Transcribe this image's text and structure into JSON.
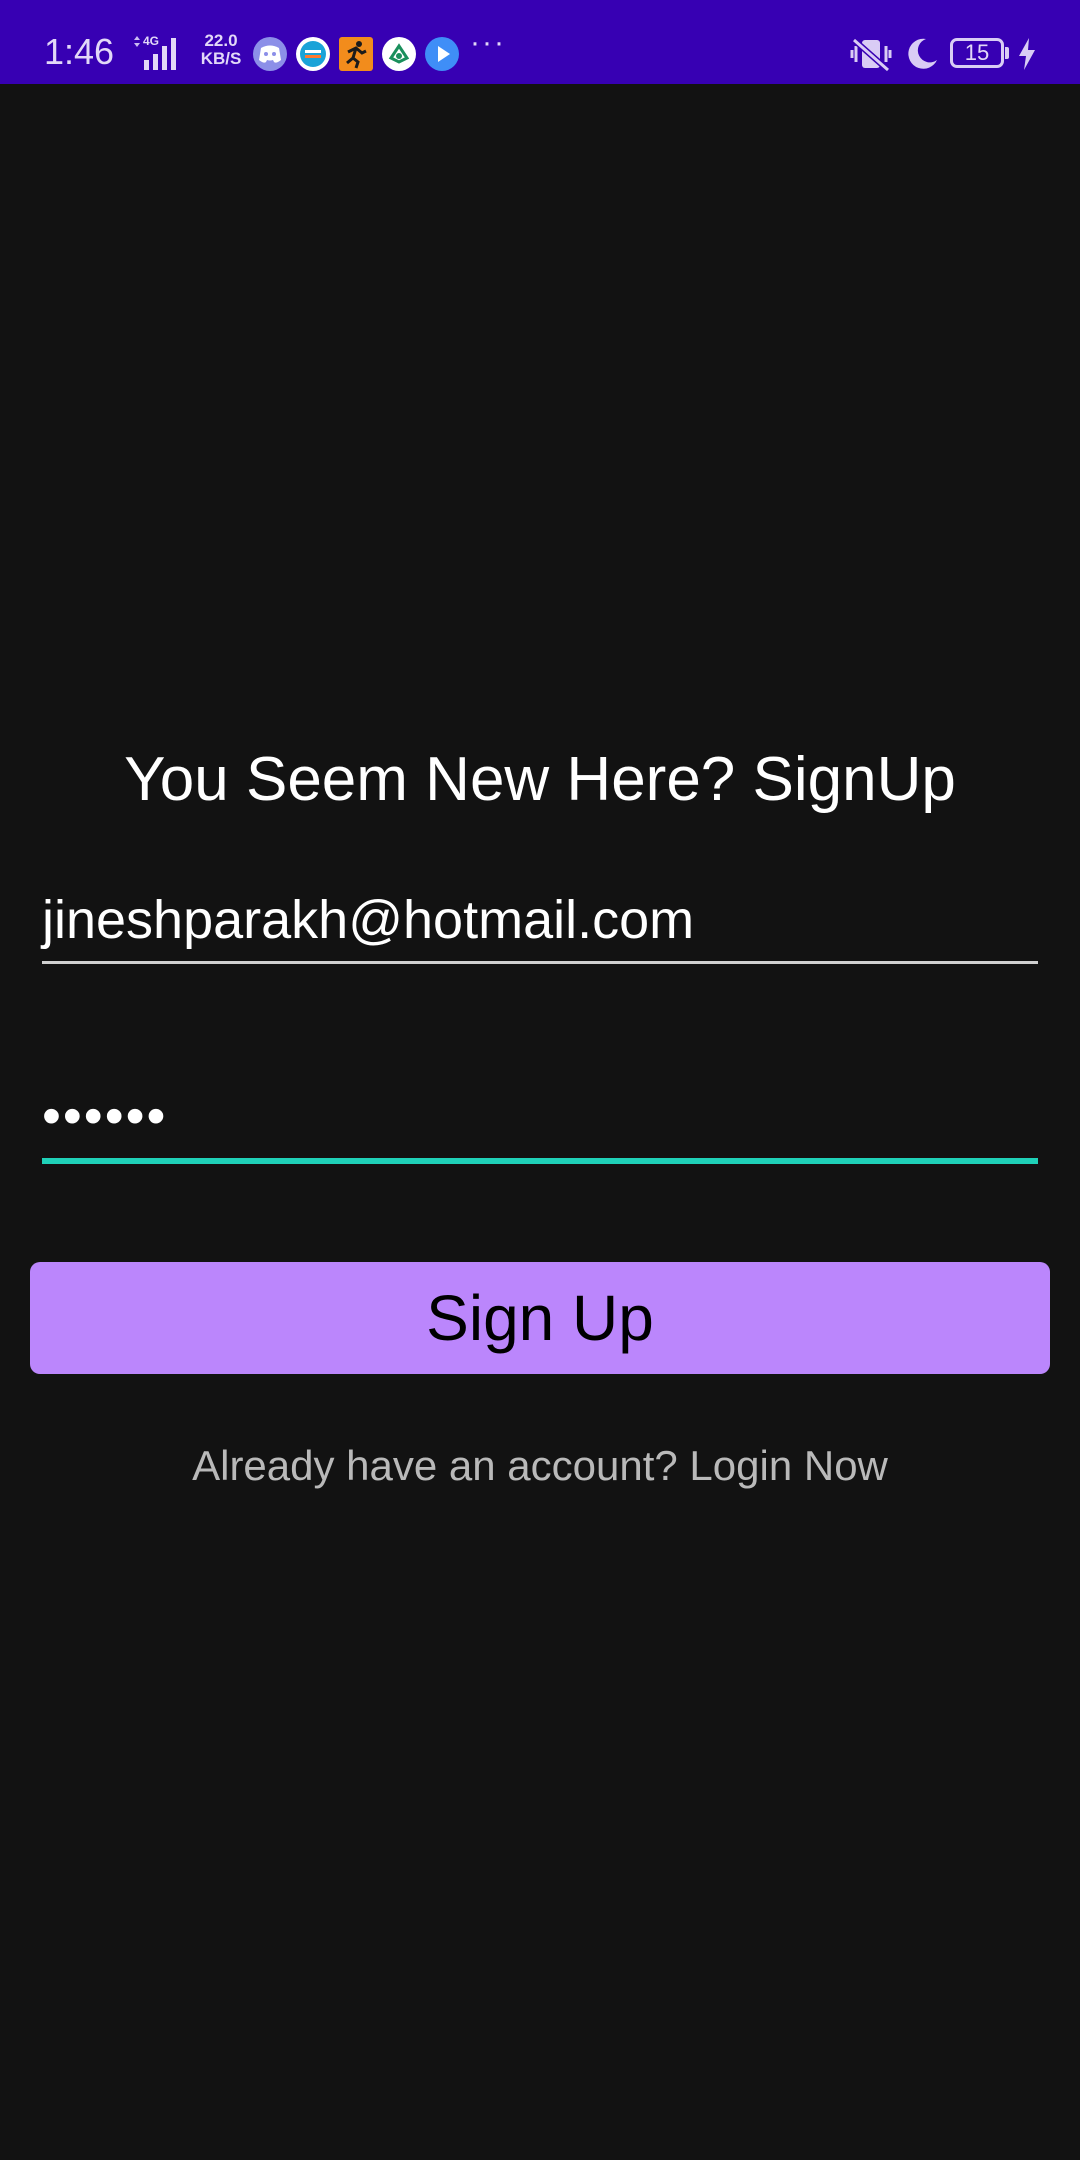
{
  "status_bar": {
    "time": "1:46",
    "network_type": "4G",
    "speed_value": "22.0",
    "speed_unit": "KB/S",
    "more": "···",
    "battery_level": "15",
    "notification_icons": [
      "discord-icon",
      "app-circle-icon",
      "runner-icon",
      "refresh-app-icon",
      "play-icon"
    ],
    "right_icons": [
      "vibrate-off-icon",
      "moon-icon",
      "battery-icon",
      "charging-bolt-icon"
    ],
    "background_color": "#3700b3"
  },
  "signup": {
    "title": "You Seem New Here? SignUp",
    "email_value": "jineshparakh@hotmail.com",
    "password_value": "••••••",
    "button_label": "Sign Up",
    "login_link": "Already have an account? Login Now"
  },
  "colors": {
    "background": "#121212",
    "button": "#bb86fc",
    "focus_underline": "#1fd1b8"
  }
}
